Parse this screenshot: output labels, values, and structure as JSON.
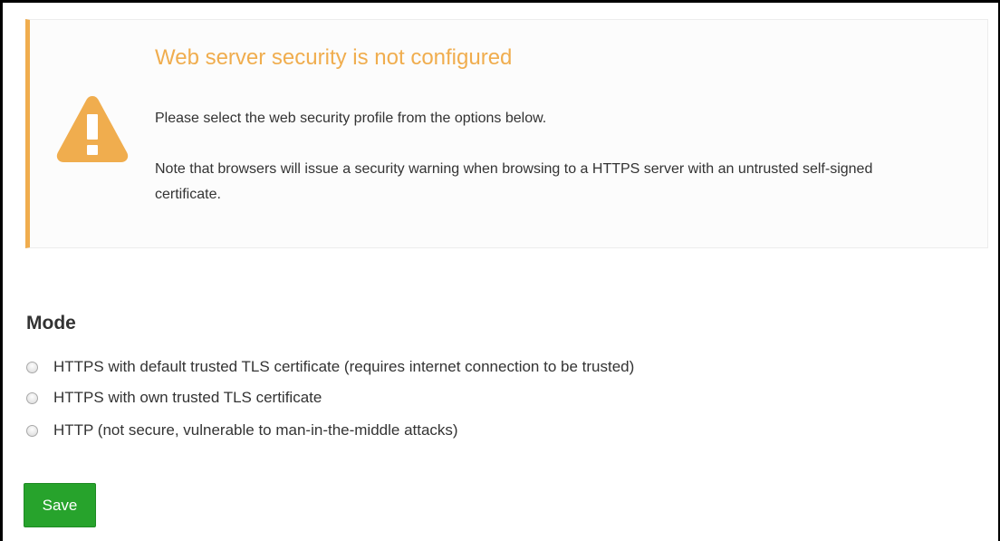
{
  "alert": {
    "icon": "warning-triangle-icon",
    "accent_color": "#f0ad4e",
    "title": "Web server security is not configured",
    "paragraph1": "Please select the web security profile from the options below.",
    "paragraph2": "Note that browsers will issue a security warning when browsing to a HTTPS server with an untrusted self-signed certificate."
  },
  "mode": {
    "heading": "Mode",
    "options": [
      {
        "label": "HTTPS with default trusted TLS certificate (requires internet connection to be trusted)",
        "selected": false
      },
      {
        "label": "HTTPS with own trusted TLS certificate",
        "selected": false
      },
      {
        "label": "HTTP (not secure, vulnerable to man-in-the-middle attacks)",
        "selected": false
      }
    ]
  },
  "actions": {
    "save_label": "Save",
    "save_color": "#27a32c"
  }
}
